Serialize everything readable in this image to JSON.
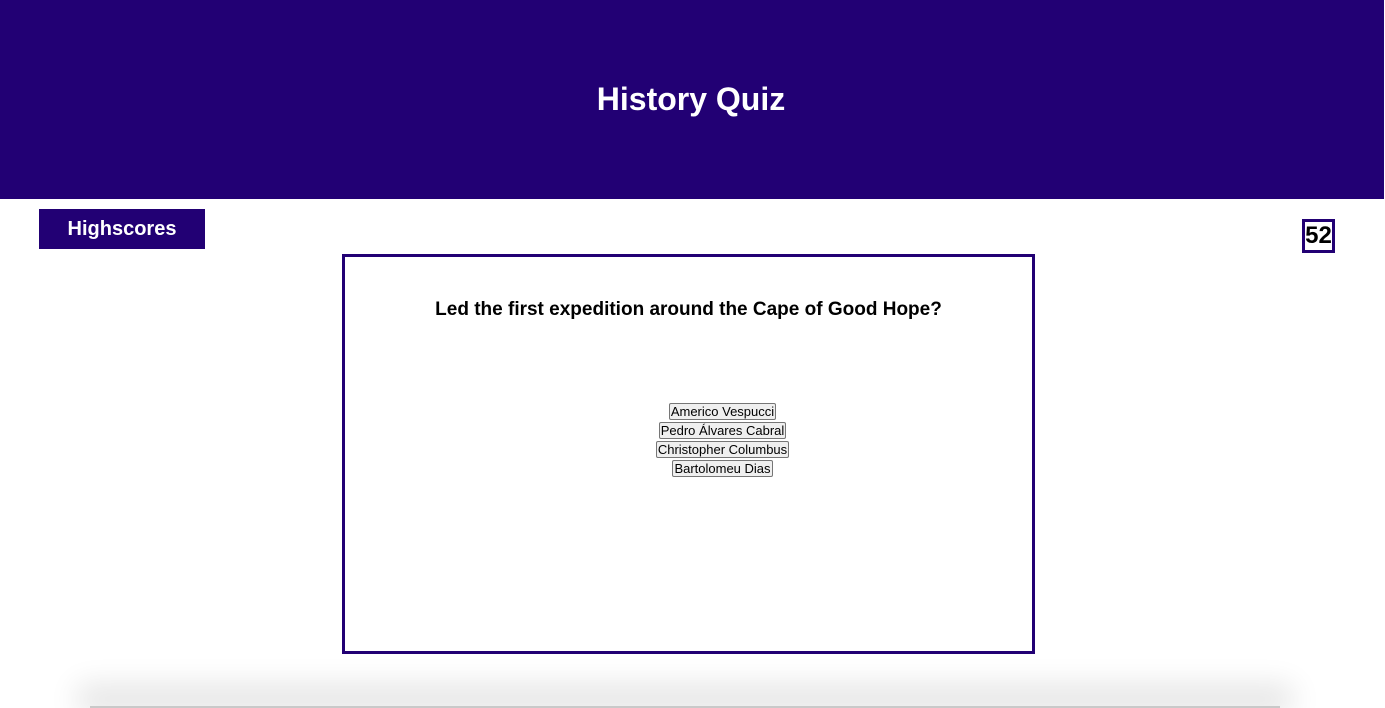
{
  "header": {
    "title": "History Quiz"
  },
  "nav": {
    "highscores_label": "Highscores"
  },
  "timer": {
    "value": "52"
  },
  "quiz": {
    "question": "Led the first expedition around the Cape of Good Hope?",
    "answers": [
      "Americo Vespucci",
      "Pedro Álvares Cabral",
      "Christopher Columbus",
      "Bartolomeu Dias"
    ]
  },
  "colors": {
    "brand": "#220074",
    "background": "#ffffff",
    "text": "#000000"
  }
}
